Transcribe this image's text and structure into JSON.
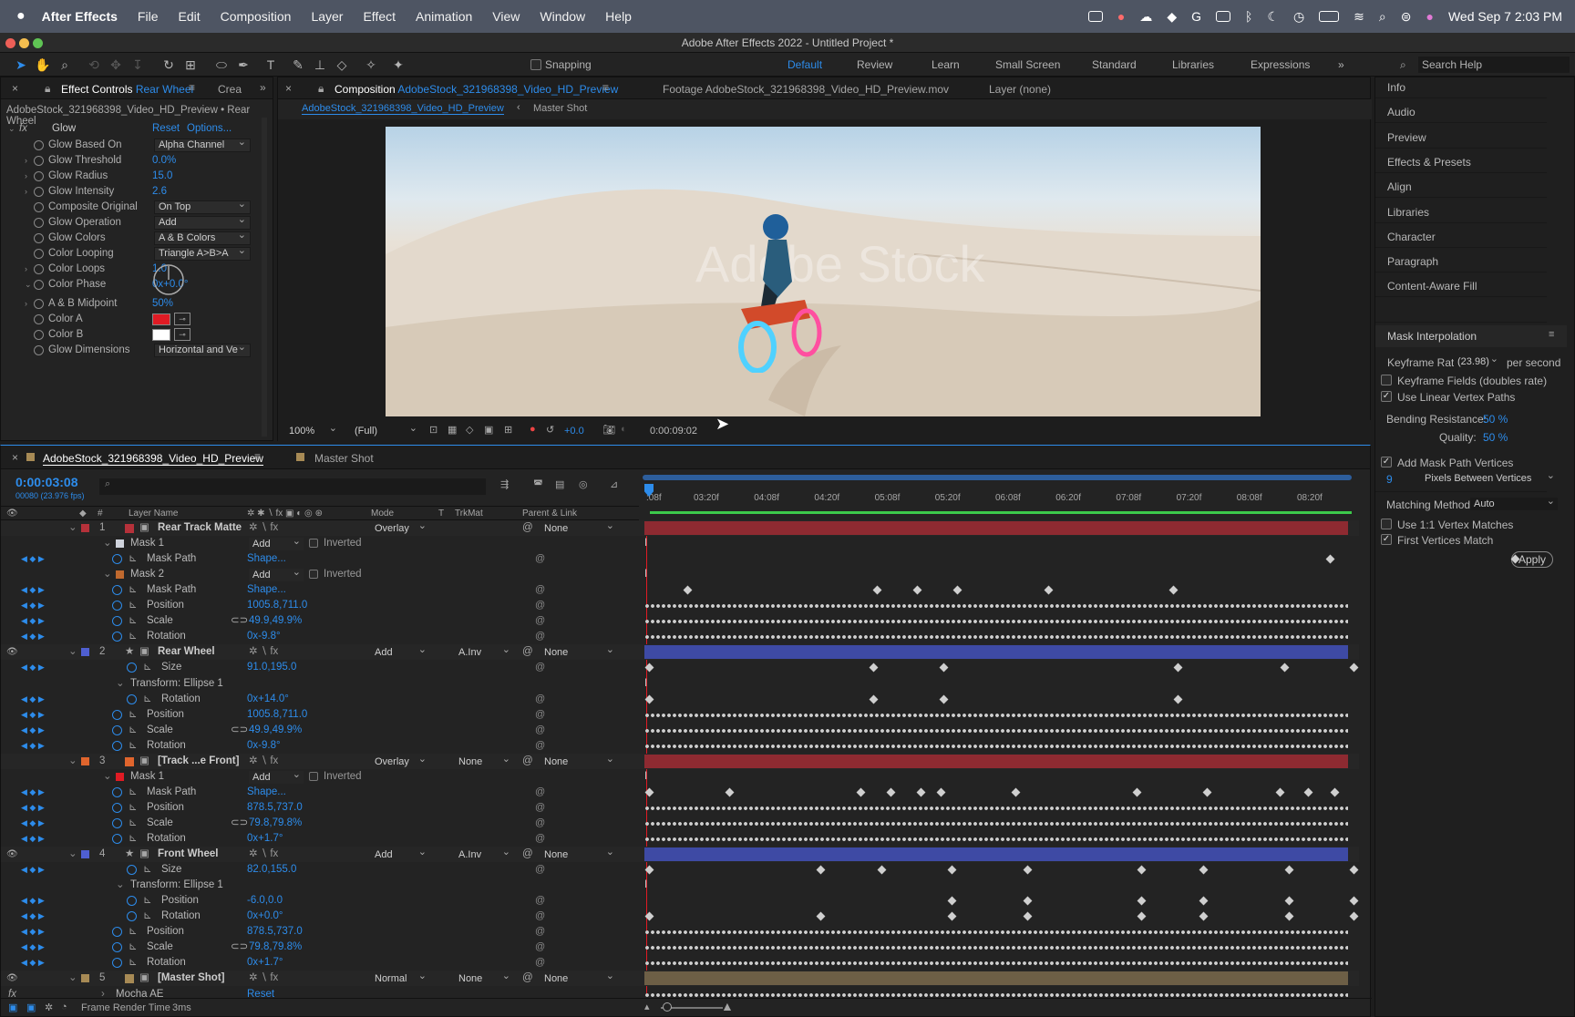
{
  "menubar": {
    "app": "After Effects",
    "items": [
      "File",
      "Edit",
      "Composition",
      "Layer",
      "Effect",
      "Animation",
      "View",
      "Window",
      "Help"
    ],
    "clock": "Wed Sep 7  2:03 PM"
  },
  "title": "Adobe After Effects 2022 - Untitled Project *",
  "toolbar": {
    "snapping": "Snapping",
    "workspaces": [
      "Default",
      "Review",
      "Learn",
      "Small Screen",
      "Standard",
      "Libraries",
      "Expressions"
    ],
    "search_placeholder": "Search Help"
  },
  "effect_controls": {
    "tab_prefix": "Effect Controls",
    "tab_layer": "Rear Wheel",
    "tab2": "Crea",
    "source": "AdobeStock_321968398_Video_HD_Preview • Rear Wheel",
    "effect": "Glow",
    "reset": "Reset",
    "options": "Options...",
    "props": [
      {
        "name": "Glow Based On",
        "value": "Alpha Channel",
        "type": "dd"
      },
      {
        "name": "Glow Threshold",
        "value": "0.0%",
        "type": "v",
        "tw": true
      },
      {
        "name": "Glow Radius",
        "value": "15.0",
        "type": "v",
        "tw": true
      },
      {
        "name": "Glow Intensity",
        "value": "2.6",
        "type": "v",
        "tw": true
      },
      {
        "name": "Composite Original",
        "value": "On Top",
        "type": "dd"
      },
      {
        "name": "Glow Operation",
        "value": "Add",
        "type": "dd"
      },
      {
        "name": "Glow Colors",
        "value": "A & B Colors",
        "type": "dd"
      },
      {
        "name": "Color Looping",
        "value": "Triangle A>B>A",
        "type": "dd"
      },
      {
        "name": "Color Loops",
        "value": "1.0",
        "type": "v",
        "tw": true
      },
      {
        "name": "Color Phase",
        "value": "0x+0.0°",
        "type": "v",
        "tw": true
      }
    ],
    "props2": [
      {
        "name": "A & B Midpoint",
        "value": "50%",
        "type": "v",
        "tw": true
      },
      {
        "name": "Color A",
        "value": "#e01b24",
        "type": "c"
      },
      {
        "name": "Color B",
        "value": "#ffffff",
        "type": "c"
      },
      {
        "name": "Glow Dimensions",
        "value": "Horizontal and Ve",
        "type": "dd"
      }
    ]
  },
  "composition": {
    "tab_prefix": "Composition",
    "tab_name": "AdobeStock_321968398_Video_HD_Preview",
    "footage_tab": "Footage AdobeStock_321968398_Video_HD_Preview.mov",
    "layer_tab": "Layer (none)",
    "breadcrumb1": "AdobeStock_321968398_Video_HD_Preview",
    "breadcrumb2": "Master Shot",
    "watermark": "Adobe Stock",
    "zoom": "100%",
    "resolution": "(Full)",
    "exposure": "+0.0",
    "timecode": "0:00:09:02"
  },
  "right_panel": {
    "items": [
      "Info",
      "Audio",
      "Preview",
      "Effects & Presets",
      "Align",
      "Libraries",
      "Character",
      "Paragraph",
      "Content-Aware Fill"
    ],
    "mask_interp": "Mask Interpolation",
    "keyframe_rate_label": "Keyframe Rate:",
    "keyframe_rate": "(23.98)",
    "per_second": "per second",
    "kf_fields": "Keyframe Fields (doubles rate)",
    "linear": "Use Linear Vertex Paths",
    "bending_label": "Bending Resistance:",
    "bending": "50 %",
    "quality_label": "Quality:",
    "quality": "50 %",
    "add_vertices": "Add Mask Path Vertices",
    "vert_count": "9",
    "vert_mode": "Pixels Between Vertices",
    "matching_label": "Matching Method:",
    "matching": "Auto",
    "use11": "Use 1:1 Vertex Matches",
    "first": "First Vertices Match",
    "apply": "Apply"
  },
  "timeline": {
    "tab": "AdobeStock_321968398_Video_HD_Preview",
    "tab2": "Master Shot",
    "timecode": "0:00:03:08",
    "frames": "00080 (23.976 fps)",
    "headers": {
      "layer": "Layer Name",
      "mode": "Mode",
      "t": "T",
      "trkmat": "TrkMat",
      "parent": "Parent & Link"
    },
    "ruler": [
      "03:20f",
      "04:08f",
      "04:20f",
      "05:08f",
      "05:20f",
      "06:08f",
      "06:20f",
      "07:08f",
      "07:20f",
      "08:08f",
      "08:20f"
    ],
    "ruler_start": ":08f",
    "rows": [
      {
        "k": "layer",
        "num": "1",
        "name": "Rear Track Matte",
        "color": "#b5313a",
        "mode": "Overlay",
        "trk": "",
        "parent": "None",
        "bar": "#8e2a31"
      },
      {
        "k": "mask",
        "name": "Mask 1",
        "mode": "Add",
        "inv": "Inverted",
        "color": "#cfd3dc"
      },
      {
        "k": "prop",
        "name": "Mask Path",
        "value": "Shape...",
        "kfs": [
          747,
          950
        ]
      },
      {
        "k": "mask",
        "name": "Mask 2",
        "mode": "Add",
        "inv": "Inverted",
        "color": "#c0692e"
      },
      {
        "k": "prop",
        "name": "Mask Path",
        "value": "Shape...",
        "kfs": [
          42,
          250,
          294,
          338,
          438,
          575
        ]
      },
      {
        "k": "prop",
        "name": "Position",
        "value": "1005.8,711.0",
        "dense": true
      },
      {
        "k": "prop",
        "name": "Scale",
        "value": "49.9,49.9%",
        "dense": true,
        "link": true
      },
      {
        "k": "prop",
        "name": "Rotation",
        "value": "0x-9.8°",
        "dense": true
      },
      {
        "k": "layer",
        "num": "2",
        "name": "Rear Wheel",
        "color": "#4f5fd1",
        "mode": "Add",
        "trk": "A.Inv",
        "parent": "None",
        "bar": "#3e4aa4",
        "star": true
      },
      {
        "k": "prop",
        "name": "Size",
        "value": "91.0,195.0",
        "kfs": [
          0,
          246,
          323,
          580,
          697,
          773
        ],
        "ind": 2
      },
      {
        "k": "group",
        "name": "Transform: Ellipse 1"
      },
      {
        "k": "prop",
        "name": "Rotation",
        "value": "0x+14.0°",
        "kfs": [
          0,
          246,
          323,
          580
        ],
        "ind": 2
      },
      {
        "k": "prop",
        "name": "Position",
        "value": "1005.8,711.0",
        "dense": true
      },
      {
        "k": "prop",
        "name": "Scale",
        "value": "49.9,49.9%",
        "dense": true,
        "link": true
      },
      {
        "k": "prop",
        "name": "Rotation",
        "value": "0x-9.8°",
        "dense": true
      },
      {
        "k": "layer",
        "num": "3",
        "name": "[Track ...e Front]",
        "color": "#e0652d",
        "mode": "Overlay",
        "trk": "None",
        "parent": "None",
        "bar": "#8e2a31"
      },
      {
        "k": "mask",
        "name": "Mask 1",
        "mode": "Add",
        "inv": "Inverted",
        "color": "#e01b24"
      },
      {
        "k": "prop",
        "name": "Mask Path",
        "value": "Shape...",
        "kfs": [
          0,
          88,
          232,
          265,
          298,
          320,
          402,
          535,
          612,
          692,
          723,
          752
        ]
      },
      {
        "k": "prop",
        "name": "Position",
        "value": "878.5,737.0",
        "dense": true
      },
      {
        "k": "prop",
        "name": "Scale",
        "value": "79.8,79.8%",
        "dense": true,
        "link": true
      },
      {
        "k": "prop",
        "name": "Rotation",
        "value": "0x+1.7°",
        "dense": true
      },
      {
        "k": "layer",
        "num": "4",
        "name": "Front Wheel",
        "color": "#4f5fd1",
        "mode": "Add",
        "trk": "A.Inv",
        "parent": "None",
        "bar": "#3e4aa4",
        "star": true
      },
      {
        "k": "prop",
        "name": "Size",
        "value": "82.0,155.0",
        "kfs": [
          0,
          188,
          255,
          332,
          415,
          540,
          608,
          702,
          773
        ],
        "ind": 2
      },
      {
        "k": "group",
        "name": "Transform: Ellipse 1"
      },
      {
        "k": "prop",
        "name": "Position",
        "value": "-6.0,0.0",
        "kfs": [
          332,
          415,
          540,
          608,
          702,
          773
        ],
        "ind": 2
      },
      {
        "k": "prop",
        "name": "Rotation",
        "value": "0x+0.0°",
        "kfs": [
          0,
          188,
          332,
          415,
          540,
          608,
          702,
          773
        ],
        "ind": 2
      },
      {
        "k": "prop",
        "name": "Position",
        "value": "878.5,737.0",
        "dense": true
      },
      {
        "k": "prop",
        "name": "Scale",
        "value": "79.8,79.8%",
        "dense": true,
        "link": true
      },
      {
        "k": "prop",
        "name": "Rotation",
        "value": "0x+1.7°",
        "dense": true
      },
      {
        "k": "layer",
        "num": "5",
        "name": "[Master Shot]",
        "color": "#a78a55",
        "mode": "Normal",
        "trk": "None",
        "parent": "None",
        "bar": "#6d5f46"
      },
      {
        "k": "effect",
        "name": "Mocha AE",
        "value": "Reset"
      }
    ],
    "footer": "Frame Render Time",
    "render_time": "3ms"
  }
}
